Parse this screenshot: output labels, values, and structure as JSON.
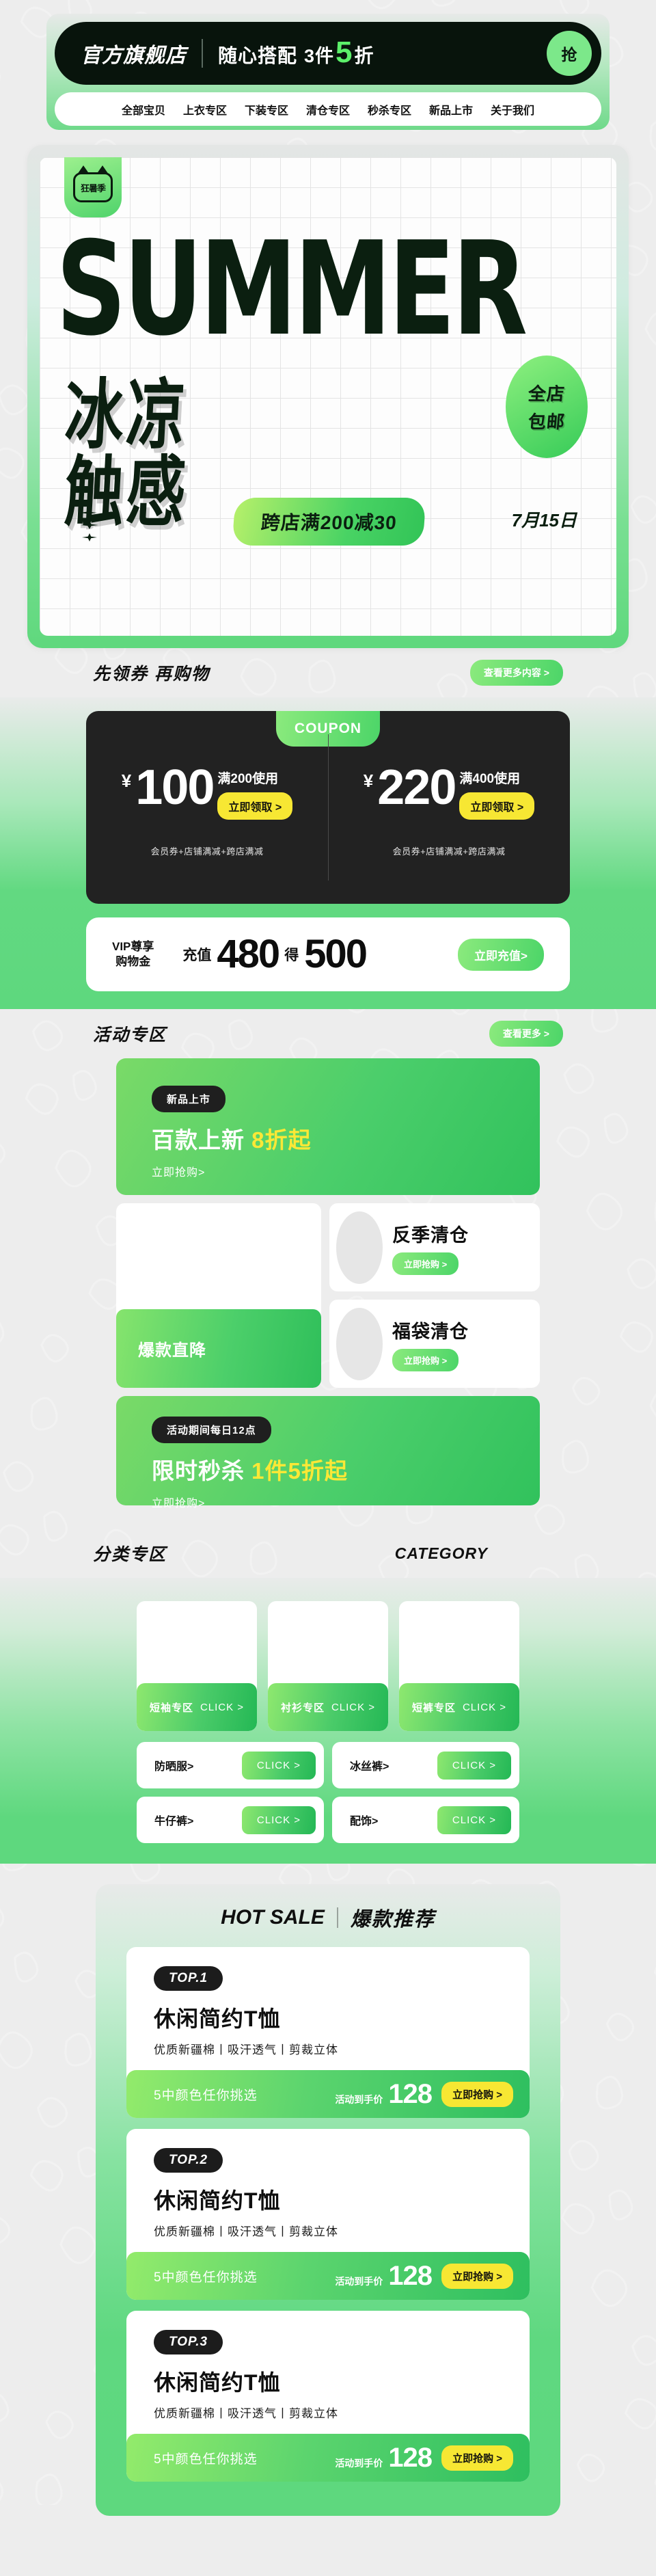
{
  "header": {
    "brand": "官方旗舰店",
    "slogan_text": "随心搭配",
    "slogan_count": "3件",
    "slogan_accent": "5",
    "slogan_unit": "折",
    "grab_label": "抢",
    "nav": [
      {
        "label": "全部宝贝"
      },
      {
        "label": "上衣专区"
      },
      {
        "label": "下装专区"
      },
      {
        "label": "清仓专区"
      },
      {
        "label": "秒杀专区"
      },
      {
        "label": "新品上市"
      },
      {
        "label": "关于我们"
      }
    ]
  },
  "hero": {
    "badge": "狂暑季",
    "title_en": "SUMMER",
    "title_cn_line1": "冰凉",
    "title_cn_line2": "触感",
    "free_shipping_line1": "全店",
    "free_shipping_line2": "包邮",
    "promo": "跨店满200减30",
    "date": "7月15日"
  },
  "coupon_section": {
    "heading": "先领券 再购物",
    "more_label": "查看更多内容 >",
    "tag": "COUPON",
    "coupons": [
      {
        "currency": "¥",
        "amount": "100",
        "condition": "满200使用",
        "button": "立即领取 >",
        "note": "会员券+店铺满减+跨店满减"
      },
      {
        "currency": "¥",
        "amount": "220",
        "condition": "满400使用",
        "button": "立即领取 >",
        "note": "会员券+店铺满减+跨店满减"
      }
    ],
    "vip": {
      "label_line1": "VIP尊享",
      "label_line2": "购物金",
      "word_recharge": "充值",
      "pay_amount": "480",
      "word_get": "得",
      "get_amount": "500",
      "button": "立即充值>"
    }
  },
  "activity_section": {
    "heading": "活动专区",
    "more_label": "查看更多 >",
    "banner_new": {
      "chip": "新品上市",
      "title": "百款上新",
      "title_highlight": "8折起",
      "link": "立即抢购>"
    },
    "left_card": {
      "label": "爆款直降"
    },
    "right_cards": [
      {
        "title": "反季清仓",
        "button": "立即抢购 >"
      },
      {
        "title": "福袋清仓",
        "button": "立即抢购 >"
      }
    ],
    "banner_flash": {
      "chip": "活动期间每日12点",
      "title": "限时秒杀",
      "title_highlight": "1件5折起",
      "link": "立即抢购>"
    }
  },
  "category_section": {
    "heading": "分类专区",
    "heading_en": "CATEGORY",
    "tiles": [
      {
        "name": "短袖专区",
        "click": "CLICK >"
      },
      {
        "name": "衬衫专区",
        "click": "CLICK >"
      },
      {
        "name": "短裤专区",
        "click": "CLICK >"
      }
    ],
    "rows": [
      {
        "label": "防晒服>",
        "click": "CLICK >"
      },
      {
        "label": "冰丝裤>",
        "click": "CLICK >"
      },
      {
        "label": "牛仔裤>",
        "click": "CLICK >"
      },
      {
        "label": "配饰>",
        "click": "CLICK >"
      }
    ]
  },
  "hot_section": {
    "heading_en": "HOT SALE",
    "heading_cn": "爆款推荐",
    "products": [
      {
        "rank": "TOP.1",
        "name": "休闲简约T恤",
        "desc": "优质新疆棉丨吸汗透气丨剪裁立体",
        "colors": "5中颜色任你挑选",
        "price_label": "活动到手价",
        "price": "128",
        "button": "立即抢购 >"
      },
      {
        "rank": "TOP.2",
        "name": "休闲简约T恤",
        "desc": "优质新疆棉丨吸汗透气丨剪裁立体",
        "colors": "5中颜色任你挑选",
        "price_label": "活动到手价",
        "price": "128",
        "button": "立即抢购 >"
      },
      {
        "rank": "TOP.3",
        "name": "休闲简约T恤",
        "desc": "优质新疆棉丨吸汗透气丨剪裁立体",
        "colors": "5中颜色任你挑选",
        "price_label": "活动到手价",
        "price": "128",
        "button": "立即抢购 >"
      }
    ]
  },
  "colors": {
    "page_bg": "#ededed",
    "brand_dark": "#08140c",
    "accent_green": "#4cd568",
    "accent_green_light": "#8bea7d",
    "accent_yellow": "#f7e733",
    "highlight_yellow": "#fbe836",
    "coupon_dark": "#222222",
    "neon_green": "#5cf06a"
  }
}
